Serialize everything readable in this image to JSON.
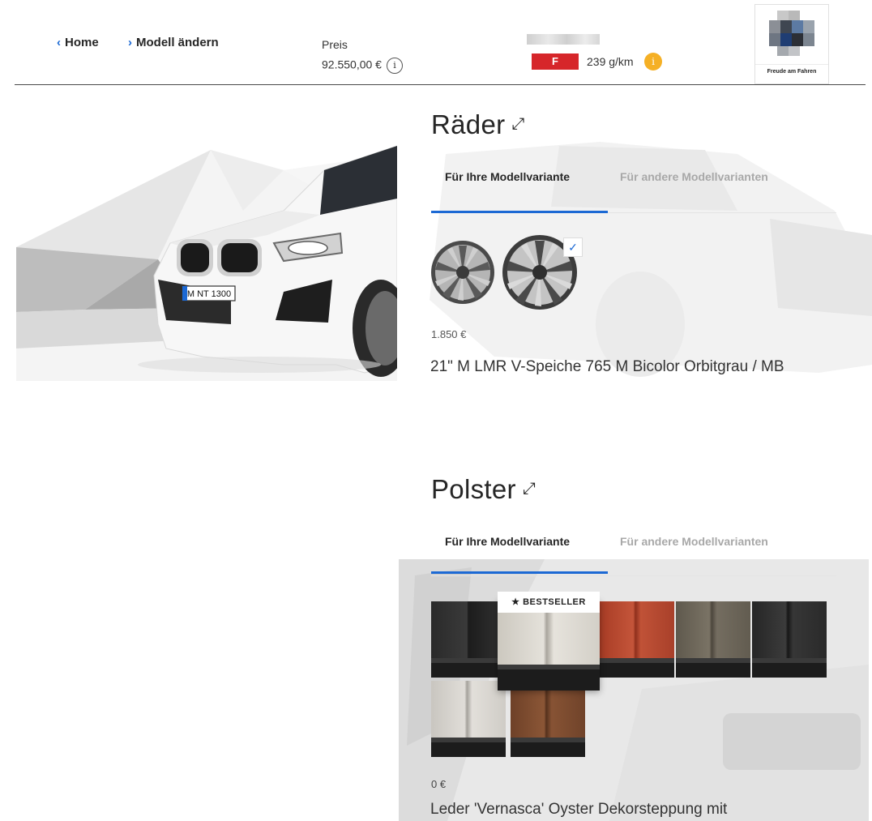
{
  "header": {
    "home_label": "Home",
    "change_model_label": "Modell ändern",
    "price_label": "Preis",
    "price_value": "92.550,00 €",
    "efficiency_class": "F",
    "emission": "239 g/km",
    "brand_slogan": "Freude am Fahren"
  },
  "wheels": {
    "title": "Räder",
    "tabs": [
      {
        "label": "Für Ihre Modellvariante",
        "active": true
      },
      {
        "label": "Für andere Modellvarianten",
        "active": false
      }
    ],
    "selected_price": "1.850 €",
    "selected_name": "21\" M LMR V-Speiche 765 M Bicolor Orbitgrau / MB"
  },
  "upholstery": {
    "title": "Polster",
    "tabs": [
      {
        "label": "Für Ihre Modellvariante",
        "active": true
      },
      {
        "label": "Für andere Modellvarianten",
        "active": false
      }
    ],
    "bestseller_label": "★ BESTSELLER",
    "selected_price": "0 €",
    "selected_name": "Leder 'Vernasca' Oyster Dekorsteppung mit",
    "swatch_colors": [
      "#2a2a2a",
      "#d9d5cd",
      "#b4452d",
      "#6d6659",
      "#2e2e2e",
      "#d4d1cb",
      "#7a4a30"
    ]
  },
  "car": {
    "license_plate": "M NT 1300"
  },
  "colors": {
    "accent": "#1c69d4",
    "efficiency_red": "#d6262a",
    "info_orange": "#f5b025"
  }
}
